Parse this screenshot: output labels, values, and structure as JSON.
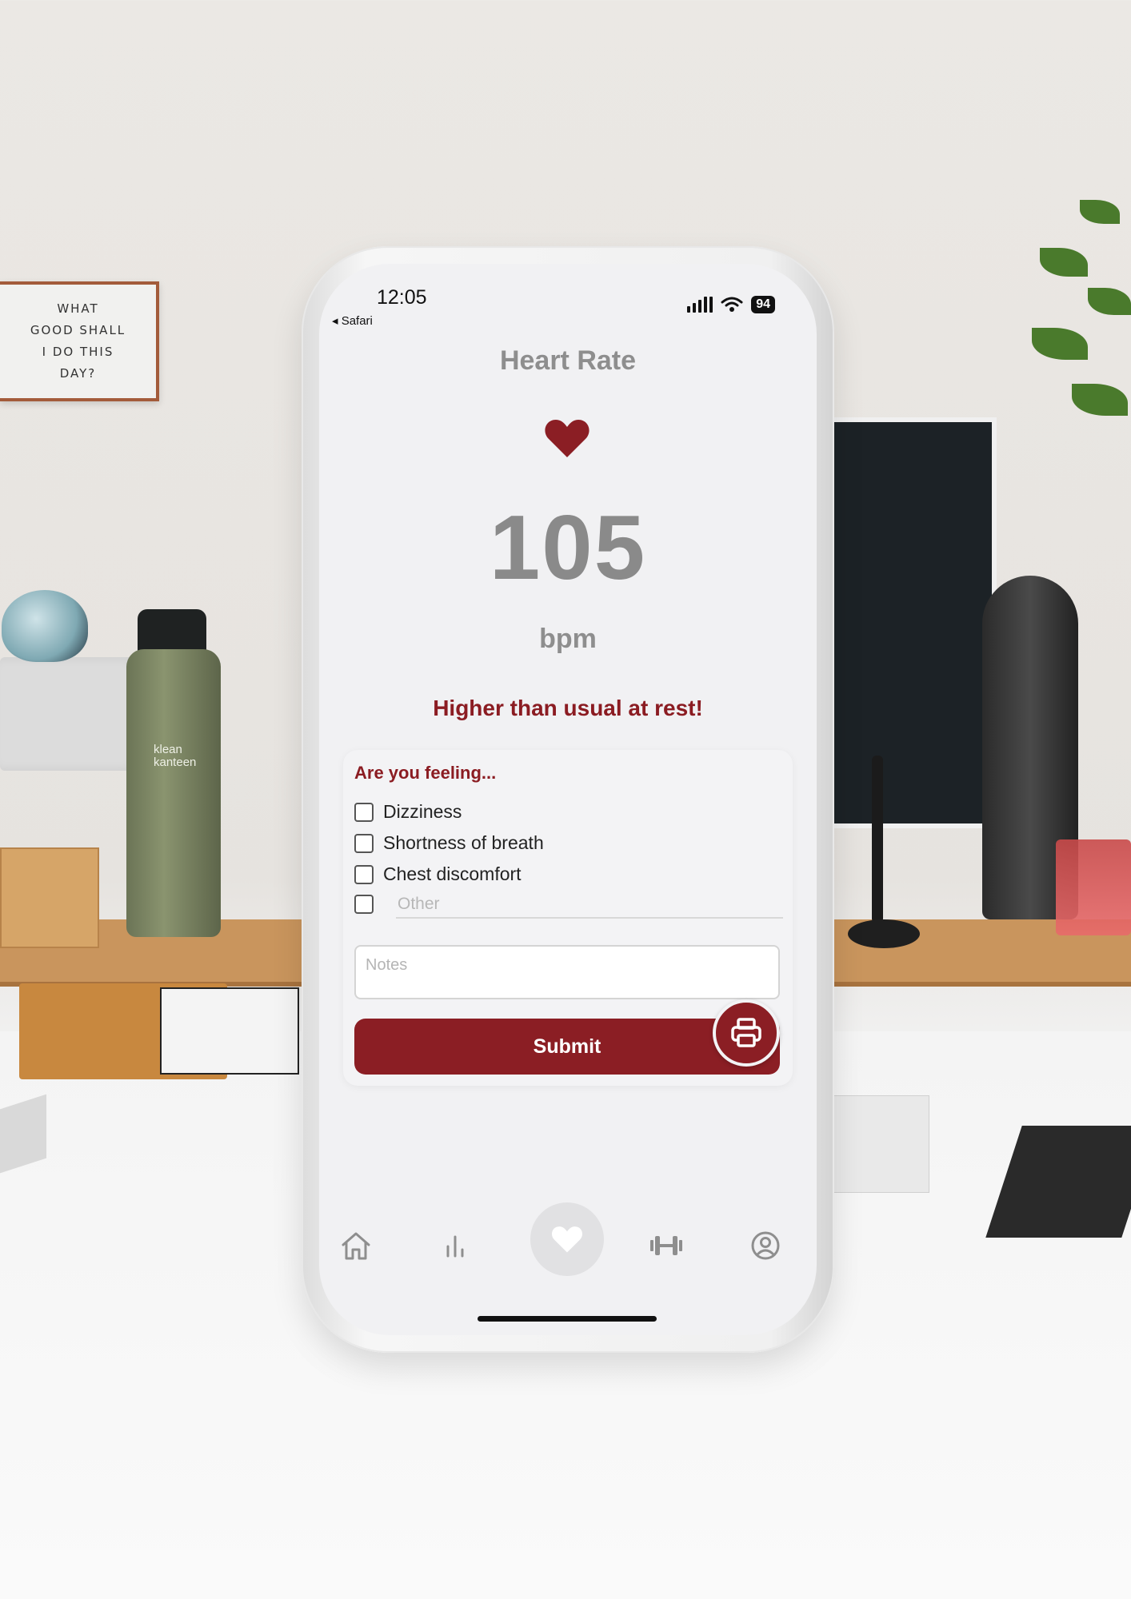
{
  "background": {
    "sign_lines": [
      "WHAT",
      "GOOD SHALL",
      "I DO THIS",
      "DAY?"
    ],
    "bottle_brand": [
      "klean",
      "kanteen"
    ]
  },
  "status_bar": {
    "time": "12:05",
    "back_label": "◂ Safari",
    "battery": "94"
  },
  "screen": {
    "title": "Heart Rate",
    "heart_rate_value": "105",
    "unit": "bpm",
    "alert": "Higher than usual at rest!",
    "accent_color": "#8b1e24"
  },
  "form": {
    "question": "Are you feeling...",
    "options": [
      {
        "label": "Dizziness",
        "checked": false
      },
      {
        "label": "Shortness of breath",
        "checked": false
      },
      {
        "label": "Chest discomfort",
        "checked": false
      }
    ],
    "other_placeholder": "Other",
    "notes_placeholder": "Notes",
    "submit_label": "Submit"
  },
  "tab_bar": {
    "items": [
      {
        "icon": "home-icon"
      },
      {
        "icon": "bar-chart-icon"
      },
      {
        "icon": "heart-icon",
        "active": true
      },
      {
        "icon": "dumbbell-icon"
      },
      {
        "icon": "profile-icon"
      }
    ]
  }
}
